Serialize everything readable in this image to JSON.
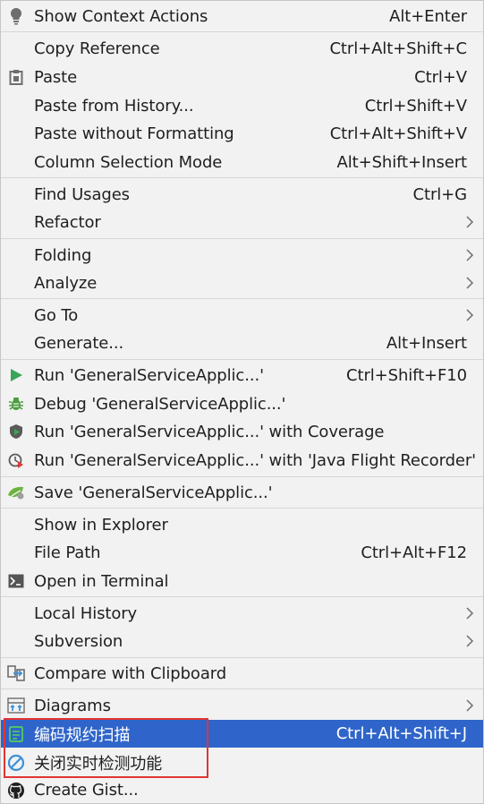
{
  "items": [
    {
      "key": "show-context-actions",
      "label": "Show Context Actions",
      "shortcut": "Alt+Enter",
      "icon": "lightbulb-icon"
    },
    {
      "key": "copy-reference",
      "label": "Copy Reference",
      "shortcut": "Ctrl+Alt+Shift+C"
    },
    {
      "key": "paste",
      "label": "Paste",
      "shortcut": "Ctrl+V",
      "icon": "clipboard-icon"
    },
    {
      "key": "paste-from-history",
      "label": "Paste from History...",
      "shortcut": "Ctrl+Shift+V"
    },
    {
      "key": "paste-without-formatting",
      "label": "Paste without Formatting",
      "shortcut": "Ctrl+Alt+Shift+V"
    },
    {
      "key": "column-selection-mode",
      "label": "Column Selection Mode",
      "shortcut": "Alt+Shift+Insert"
    },
    {
      "key": "find-usages",
      "label": "Find Usages",
      "shortcut": "Ctrl+G"
    },
    {
      "key": "refactor",
      "label": "Refactor",
      "submenu": true
    },
    {
      "key": "folding",
      "label": "Folding",
      "submenu": true
    },
    {
      "key": "analyze",
      "label": "Analyze",
      "submenu": true
    },
    {
      "key": "go-to",
      "label": "Go To",
      "submenu": true
    },
    {
      "key": "generate",
      "label": "Generate...",
      "shortcut": "Alt+Insert"
    },
    {
      "key": "run",
      "label": "Run 'GeneralServiceApplic...'",
      "shortcut": "Ctrl+Shift+F10",
      "icon": "run-icon"
    },
    {
      "key": "debug",
      "label": "Debug 'GeneralServiceApplic...'",
      "icon": "bug-icon"
    },
    {
      "key": "run-with-coverage",
      "label": "Run 'GeneralServiceApplic...' with Coverage",
      "icon": "coverage-icon"
    },
    {
      "key": "run-with-jfr",
      "label": "Run 'GeneralServiceApplic...' with 'Java Flight Recorder'",
      "icon": "profiler-icon"
    },
    {
      "key": "save-config",
      "label": "Save 'GeneralServiceApplic...'",
      "icon": "spring-icon"
    },
    {
      "key": "show-in-explorer",
      "label": "Show in Explorer"
    },
    {
      "key": "file-path",
      "label": "File Path",
      "shortcut": "Ctrl+Alt+F12"
    },
    {
      "key": "open-in-terminal",
      "label": "Open in Terminal",
      "icon": "terminal-icon"
    },
    {
      "key": "local-history",
      "label": "Local History",
      "submenu": true
    },
    {
      "key": "subversion",
      "label": "Subversion",
      "submenu": true
    },
    {
      "key": "compare-with-clipboard",
      "label": "Compare with Clipboard",
      "icon": "compare-icon"
    },
    {
      "key": "diagrams",
      "label": "Diagrams",
      "submenu": true,
      "icon": "diagram-icon"
    },
    {
      "key": "code-scan",
      "label": "编码规约扫描",
      "shortcut": "Ctrl+Alt+Shift+J",
      "icon": "scan-icon",
      "highlighted": true
    },
    {
      "key": "disable-realtime-check",
      "label": "关闭实时检测功能",
      "icon": "forbidden-icon"
    },
    {
      "key": "create-gist",
      "label": "Create Gist...",
      "icon": "github-icon"
    }
  ],
  "colors": {
    "background": "#f2f2f2",
    "highlight": "#2f65ca",
    "separator": "#d6d6d6",
    "annotation_box": "#e23434"
  }
}
